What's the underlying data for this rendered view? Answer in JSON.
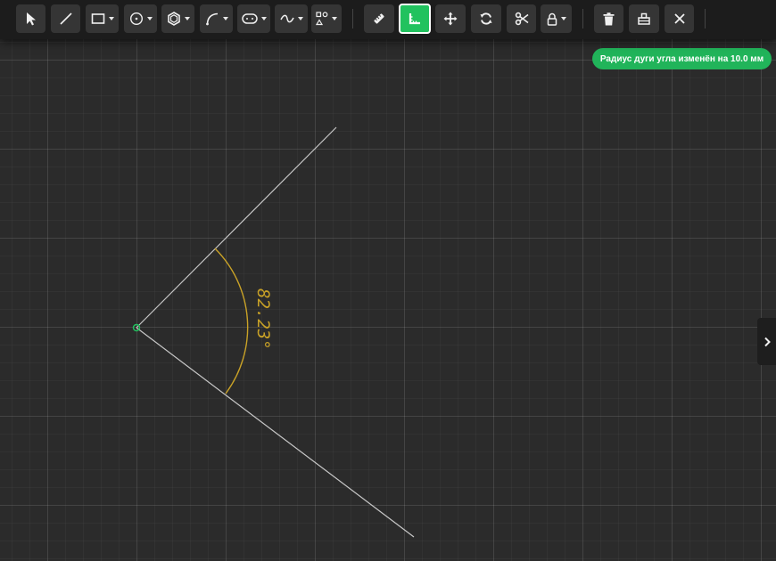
{
  "toolbar": {
    "tools": [
      {
        "id": "select",
        "icon": "cursor-arrow-icon",
        "dropdown": false
      },
      {
        "id": "line",
        "icon": "line-icon",
        "dropdown": false
      },
      {
        "id": "rectangle",
        "icon": "rectangle-icon",
        "dropdown": true
      },
      {
        "id": "circle",
        "icon": "circle-icon",
        "dropdown": true
      },
      {
        "id": "polygon",
        "icon": "hexagon-icon",
        "dropdown": true
      },
      {
        "id": "arc",
        "icon": "arc-icon",
        "dropdown": true
      },
      {
        "id": "slot",
        "icon": "slot-icon",
        "dropdown": true
      },
      {
        "id": "spline",
        "icon": "spline-icon",
        "dropdown": true
      },
      {
        "id": "pattern",
        "icon": "pattern-icon",
        "dropdown": true
      },
      {
        "id": "measure",
        "icon": "ruler-icon",
        "dropdown": false
      },
      {
        "id": "angle-dimension",
        "icon": "angle-dimension-icon",
        "dropdown": false,
        "active": true
      },
      {
        "id": "move",
        "icon": "move-icon",
        "dropdown": false
      },
      {
        "id": "rotate",
        "icon": "rotate-icon",
        "dropdown": false
      },
      {
        "id": "trim",
        "icon": "scissors-icon",
        "dropdown": false
      },
      {
        "id": "lock",
        "icon": "lock-icon",
        "dropdown": true
      },
      {
        "id": "delete",
        "icon": "trash-icon",
        "dropdown": false
      },
      {
        "id": "erase",
        "icon": "eraser-icon",
        "dropdown": false
      },
      {
        "id": "close",
        "icon": "close-icon",
        "dropdown": false
      }
    ]
  },
  "notification": {
    "text": "Радиус дуги угла изменён на 10.0 мм"
  },
  "sketch": {
    "angle_label": "82.23°",
    "angle_degrees": 82.23,
    "arc_radius_mm": 10.0
  },
  "colors": {
    "background": "#2b2b2b",
    "toolbar": "#1c1c1c",
    "button": "#353535",
    "accent": "#21c25e",
    "sketch_line": "#c8c8c8",
    "dimension": "#c9a227",
    "vertex": "#21c25e"
  },
  "side_panel": {
    "icon": "chevron-right-icon"
  }
}
